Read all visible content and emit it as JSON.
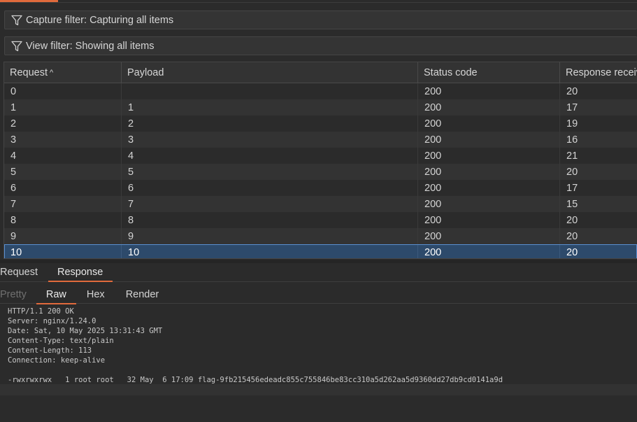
{
  "filters": {
    "capture": "Capture filter: Capturing all items",
    "view": "View filter: Showing all items"
  },
  "table": {
    "headers": {
      "request": "Request",
      "payload": "Payload",
      "status": "Status code",
      "response": "Response received"
    },
    "sort_indicator": "^",
    "rows": [
      {
        "request": "0",
        "payload": "",
        "status": "200",
        "response": "20"
      },
      {
        "request": "1",
        "payload": "1",
        "status": "200",
        "response": "17"
      },
      {
        "request": "2",
        "payload": "2",
        "status": "200",
        "response": "19"
      },
      {
        "request": "3",
        "payload": "3",
        "status": "200",
        "response": "16"
      },
      {
        "request": "4",
        "payload": "4",
        "status": "200",
        "response": "21"
      },
      {
        "request": "5",
        "payload": "5",
        "status": "200",
        "response": "20"
      },
      {
        "request": "6",
        "payload": "6",
        "status": "200",
        "response": "17"
      },
      {
        "request": "7",
        "payload": "7",
        "status": "200",
        "response": "15"
      },
      {
        "request": "8",
        "payload": "8",
        "status": "200",
        "response": "20"
      },
      {
        "request": "9",
        "payload": "9",
        "status": "200",
        "response": "20"
      },
      {
        "request": "10",
        "payload": "10",
        "status": "200",
        "response": "20"
      }
    ],
    "selected_index": 10
  },
  "message_tabs": {
    "request": "Request",
    "response": "Response"
  },
  "view_tabs": {
    "pretty": "Pretty",
    "raw": "Raw",
    "hex": "Hex",
    "render": "Render"
  },
  "response_lines": [
    "HTTP/1.1 200 OK",
    "Server: nginx/1.24.0",
    "Date: Sat, 10 May 2025 13:31:43 GMT",
    "Content-Type: text/plain",
    "Content-Length: 113",
    "Connection: keep-alive",
    "",
    "-rwxrwxrwx   1 root root   32 May  6 17:09 flag-9fb215456edeadc855c755846be83cc310a5d262aa5d9360dd27db9cd0141a9d"
  ],
  "colors": {
    "accent": "#e06a3c",
    "selection": "#2d4a6b",
    "background": "#2b2b2b"
  },
  "icons": {
    "filter": "filter-funnel-icon"
  }
}
